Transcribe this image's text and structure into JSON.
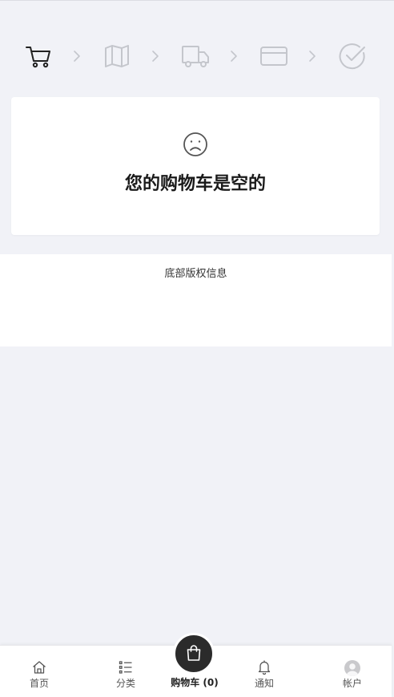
{
  "checkout_steps": [
    {
      "name": "cart",
      "icon": "cart-icon",
      "active": true
    },
    {
      "name": "address",
      "icon": "map-icon",
      "active": false
    },
    {
      "name": "shipping",
      "icon": "truck-icon",
      "active": false
    },
    {
      "name": "payment",
      "icon": "card-icon",
      "active": false
    },
    {
      "name": "done",
      "icon": "check-circle-icon",
      "active": false
    }
  ],
  "empty_cart": {
    "icon": "sad-face-icon",
    "message": "您的购物车是空的"
  },
  "footer": {
    "copyright": "底部版权信息"
  },
  "tabbar": {
    "home": "首页",
    "category": "分类",
    "cart": "购物车 (0)",
    "notify": "通知",
    "account": "帐户"
  },
  "colors": {
    "page_bg": "#f1f2f7",
    "active_icon": "#222222",
    "inactive_icon": "#c4c6cc",
    "cart_bubble": "#2b2b2b"
  }
}
